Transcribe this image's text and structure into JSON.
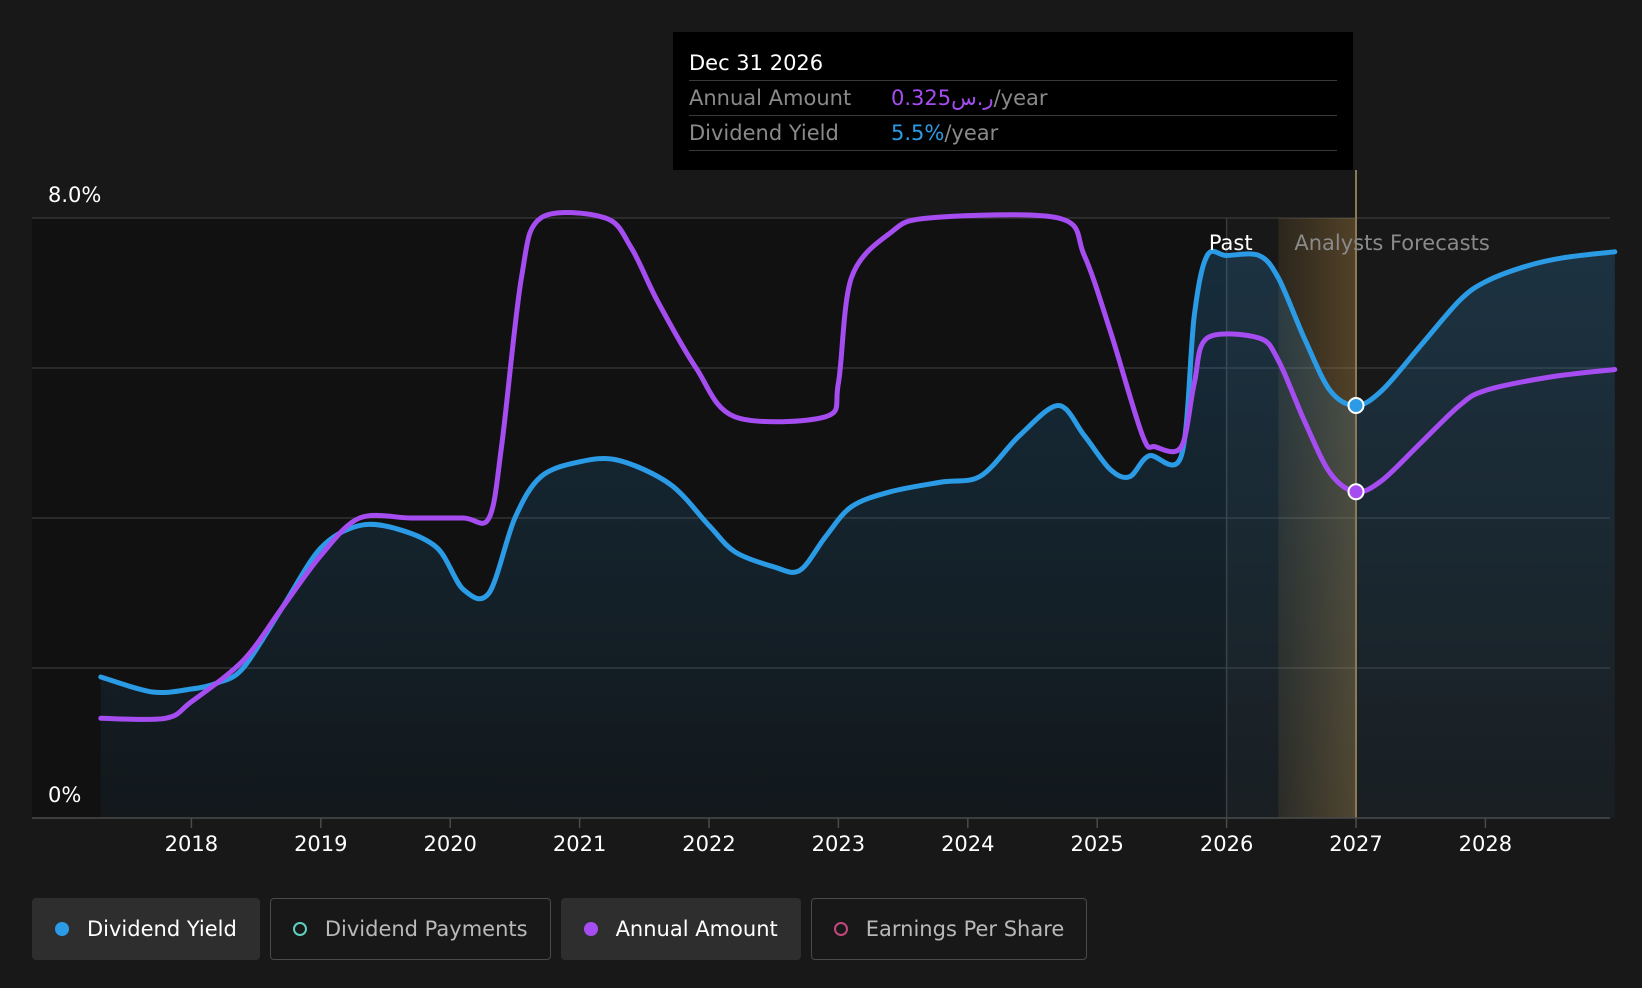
{
  "colors": {
    "dividend_yield": "#2b9be6",
    "dividend_payments": "#5fcfc0",
    "annual_amount": "#a64df2",
    "earnings_per_share": "#c0487c",
    "forecast_band": "#d9a24a",
    "background": "#181818"
  },
  "tooltip": {
    "date": "Dec 31 2026",
    "annual_label": "Annual Amount",
    "annual_value": "0.325ر.س",
    "annual_unit": "/year",
    "yield_label": "Dividend Yield",
    "yield_value": "5.5%",
    "yield_unit": "/year"
  },
  "regions": {
    "past": "Past",
    "forecast": "Analysts Forecasts"
  },
  "legend": [
    {
      "label": "Dividend Yield",
      "icon": "filled-dot-icon",
      "active": true
    },
    {
      "label": "Dividend Payments",
      "icon": "hollow-dot-icon",
      "active": false
    },
    {
      "label": "Annual Amount",
      "icon": "filled-dot-icon",
      "active": true
    },
    {
      "label": "Earnings Per Share",
      "icon": "hollow-dot-icon",
      "active": false
    }
  ],
  "chart_data": {
    "type": "line",
    "ylabel_top": "8.0%",
    "ylabel_bottom": "0%",
    "ylim": [
      0,
      8
    ],
    "xlim": [
      2016.8,
      2029.0
    ],
    "x_ticks": [
      "2018",
      "2019",
      "2020",
      "2021",
      "2022",
      "2023",
      "2024",
      "2025",
      "2026",
      "2027",
      "2028"
    ],
    "past_end": 2026.0,
    "forecast_shade_start": 2026.4,
    "cursor_x": 2027.0,
    "series": [
      {
        "name": "Dividend Yield",
        "color": "#2b9be6",
        "area": true,
        "points": [
          [
            2017.3,
            1.88
          ],
          [
            2017.7,
            1.68
          ],
          [
            2018.0,
            1.72
          ],
          [
            2018.2,
            1.8
          ],
          [
            2018.4,
            2.0
          ],
          [
            2018.7,
            2.8
          ],
          [
            2019.0,
            3.6
          ],
          [
            2019.3,
            3.9
          ],
          [
            2019.6,
            3.85
          ],
          [
            2019.9,
            3.6
          ],
          [
            2020.1,
            3.05
          ],
          [
            2020.3,
            3.0
          ],
          [
            2020.5,
            4.0
          ],
          [
            2020.7,
            4.55
          ],
          [
            2021.0,
            4.75
          ],
          [
            2021.3,
            4.77
          ],
          [
            2021.7,
            4.45
          ],
          [
            2022.0,
            3.9
          ],
          [
            2022.2,
            3.55
          ],
          [
            2022.5,
            3.35
          ],
          [
            2022.7,
            3.3
          ],
          [
            2022.9,
            3.75
          ],
          [
            2023.1,
            4.15
          ],
          [
            2023.4,
            4.35
          ],
          [
            2023.8,
            4.48
          ],
          [
            2024.1,
            4.56
          ],
          [
            2024.4,
            5.1
          ],
          [
            2024.7,
            5.5
          ],
          [
            2024.9,
            5.1
          ],
          [
            2025.1,
            4.65
          ],
          [
            2025.25,
            4.55
          ],
          [
            2025.4,
            4.83
          ],
          [
            2025.65,
            4.83
          ],
          [
            2025.75,
            6.7
          ],
          [
            2025.85,
            7.5
          ],
          [
            2026.0,
            7.5
          ],
          [
            2026.25,
            7.5
          ],
          [
            2026.4,
            7.2
          ],
          [
            2026.6,
            6.4
          ],
          [
            2026.8,
            5.7
          ],
          [
            2027.0,
            5.5
          ],
          [
            2027.2,
            5.7
          ],
          [
            2027.5,
            6.3
          ],
          [
            2027.8,
            6.9
          ],
          [
            2028.0,
            7.15
          ],
          [
            2028.3,
            7.35
          ],
          [
            2028.6,
            7.47
          ],
          [
            2029.0,
            7.55
          ]
        ]
      },
      {
        "name": "Annual Amount",
        "color": "#a64df2",
        "area": false,
        "points": [
          [
            2017.3,
            1.33
          ],
          [
            2017.8,
            1.33
          ],
          [
            2018.0,
            1.55
          ],
          [
            2018.4,
            2.1
          ],
          [
            2018.7,
            2.8
          ],
          [
            2019.0,
            3.5
          ],
          [
            2019.3,
            4.0
          ],
          [
            2019.7,
            4.0
          ],
          [
            2020.1,
            4.0
          ],
          [
            2020.3,
            4.0
          ],
          [
            2020.4,
            5.0
          ],
          [
            2020.55,
            7.2
          ],
          [
            2020.7,
            8.0
          ],
          [
            2021.2,
            8.0
          ],
          [
            2021.4,
            7.6
          ],
          [
            2021.6,
            6.9
          ],
          [
            2021.9,
            6.0
          ],
          [
            2022.2,
            5.35
          ],
          [
            2022.9,
            5.35
          ],
          [
            2023.0,
            5.8
          ],
          [
            2023.1,
            7.2
          ],
          [
            2023.4,
            7.8
          ],
          [
            2023.7,
            8.0
          ],
          [
            2024.7,
            8.0
          ],
          [
            2024.9,
            7.5
          ],
          [
            2025.1,
            6.5
          ],
          [
            2025.35,
            5.1
          ],
          [
            2025.45,
            4.95
          ],
          [
            2025.65,
            4.95
          ],
          [
            2025.75,
            5.8
          ],
          [
            2025.85,
            6.4
          ],
          [
            2026.25,
            6.4
          ],
          [
            2026.4,
            6.1
          ],
          [
            2026.6,
            5.3
          ],
          [
            2026.8,
            4.6
          ],
          [
            2027.0,
            4.35
          ],
          [
            2027.2,
            4.5
          ],
          [
            2027.5,
            5.0
          ],
          [
            2027.8,
            5.5
          ],
          [
            2028.0,
            5.7
          ],
          [
            2028.5,
            5.88
          ],
          [
            2029.0,
            5.98
          ]
        ]
      }
    ],
    "markers": [
      {
        "series": "Dividend Yield",
        "x": 2027.0,
        "y": 5.5
      },
      {
        "series": "Annual Amount",
        "x": 2027.0,
        "y": 4.35
      }
    ]
  }
}
